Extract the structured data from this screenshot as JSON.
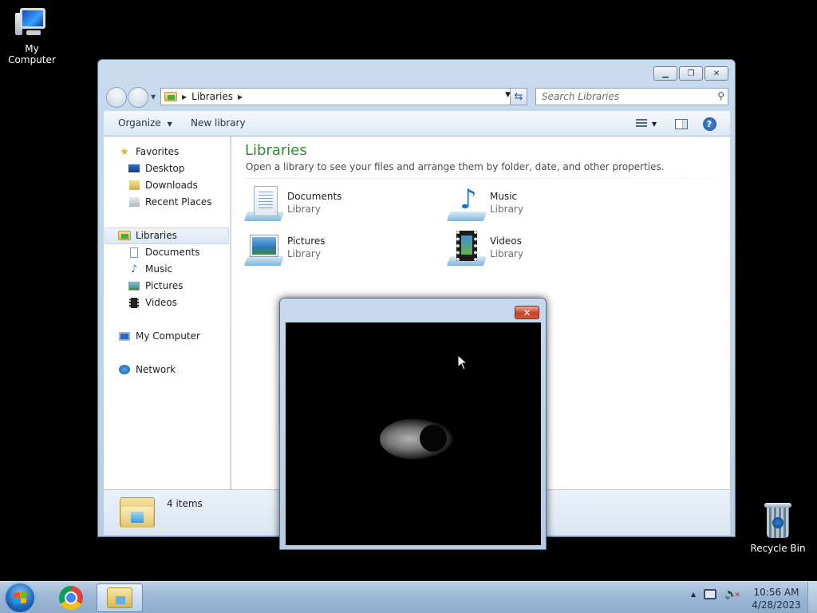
{
  "desktop": {
    "icons": [
      {
        "label": "My Computer",
        "icon": "computer-icon"
      },
      {
        "label": "Recycle Bin",
        "icon": "recycle-bin-icon"
      }
    ]
  },
  "explorer": {
    "address": {
      "crumbs": [
        "Libraries"
      ]
    },
    "search": {
      "placeholder": "Search Libraries"
    },
    "toolbar": {
      "organize": "Organize",
      "new_library": "New library"
    },
    "nav": {
      "favorites": "Favorites",
      "favorites_items": [
        "Desktop",
        "Downloads",
        "Recent Places"
      ],
      "libraries": "Libraries",
      "libraries_items": [
        "Documents",
        "Music",
        "Pictures",
        "Videos"
      ],
      "computer": "My Computer",
      "network": "Network"
    },
    "content": {
      "title": "Libraries",
      "subtitle": "Open a library to see your files and arrange them by folder, date, and other properties.",
      "items": [
        {
          "name": "Documents",
          "type": "Library",
          "icon": "documents-library-icon"
        },
        {
          "name": "Music",
          "type": "Library",
          "icon": "music-library-icon"
        },
        {
          "name": "Pictures",
          "type": "Library",
          "icon": "pictures-library-icon"
        },
        {
          "name": "Videos",
          "type": "Library",
          "icon": "videos-library-icon"
        }
      ]
    },
    "details": {
      "count": "4 items"
    }
  },
  "dialog": {
    "close_glyph": "✕"
  },
  "taskbar": {
    "apps": [
      "start-orb",
      "chrome-icon",
      "explorer-icon"
    ],
    "tray_arrow": "▲",
    "clock": {
      "time": "10:56 AM",
      "date": "4/28/2023"
    }
  },
  "colors": {
    "library_title": "#2e8f2e",
    "close_red": "#c7412b"
  }
}
